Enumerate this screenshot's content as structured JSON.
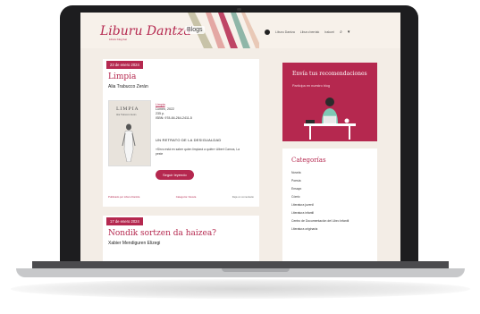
{
  "header": {
    "logo": "Liburu Dantza",
    "logo_sub": "Liburu blog bat",
    "blog_badge": "Blogs",
    "nav": [
      "Liburu Dantza",
      "Liburu berriak",
      "Irakurri"
    ]
  },
  "posts": [
    {
      "date": "23 de enero 2024",
      "title": "Limpia",
      "author": "Alia Trabucco Zerán",
      "cover_title": "LIMPIA",
      "cover_author": "Alia Trabucco Zerán",
      "meta_link": "Limpia",
      "meta_lines": [
        "Lumen, 2022",
        "235 p.",
        "ISBN: 978-84-264-2411-5"
      ],
      "excerpt_head": "UN RETRATO DE LA DESIGUALDAD",
      "quote": "«Sirvo está en saber quien limpiará a quién» Albert Camus, La peste",
      "button": "Seguir leyendo",
      "footer_left": "Publicado por Liburu Dantza",
      "footer_mid": "Categoría: Novela",
      "footer_right": "Deja un comentario"
    },
    {
      "date": "17 de enero 2024",
      "title": "Nondik sortzen da haizea?",
      "author": "Xabier Mendiguren Elizegi"
    }
  ],
  "sidebar": {
    "promo_title": "Envía tus recomendaciones",
    "promo_sub": "Participa en nuestro blog",
    "categories_title": "Categorías",
    "categories": [
      "Novela",
      "Poesía",
      "Ensayo",
      "Cómic",
      "Literatura juvenil",
      "Literatura infantil",
      "Centro de Documentación del Libro Infantil",
      "Literatura originaria"
    ]
  },
  "colors": {
    "accent": "#b5284f",
    "page_bg": "#f3ede6"
  }
}
